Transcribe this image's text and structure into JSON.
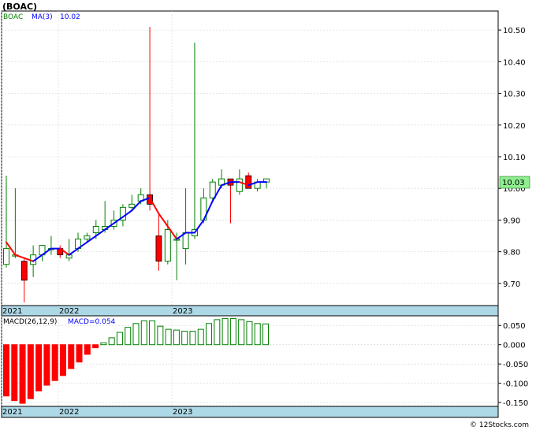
{
  "header": {
    "ticker": "(BOAC)"
  },
  "price_legend": {
    "symbol": "BOAC",
    "ma_label": "MA(3)",
    "ma_value": "10.02"
  },
  "macd_legend": {
    "label": "MACD(26,12,9)",
    "value_label": "MACD=0.054"
  },
  "last_price_tag": "10.03",
  "watermark": "© 12Stocks.com",
  "colors": {
    "up": "#008000",
    "down": "#ff0000",
    "ma_up": "#0000ff",
    "ma_down": "#ff0000",
    "axis_band": "#add8e6",
    "last_tag": "#90ee90"
  },
  "chart_data": [
    {
      "type": "candlestick",
      "title": "(BOAC)",
      "x_ticks": [
        "2021",
        "2022",
        "2023"
      ],
      "y_ticks": [
        "9.70",
        "9.80",
        "9.90",
        "10.00",
        "10.10",
        "10.20",
        "10.30",
        "10.40",
        "10.50"
      ],
      "ylim": [
        9.63,
        10.56
      ],
      "grid": true,
      "candles": [
        {
          "o": 9.76,
          "h": 10.04,
          "l": 9.75,
          "c": 9.81
        },
        {
          "o": 9.79,
          "h": 10.0,
          "l": 9.78,
          "c": 9.79
        },
        {
          "o": 9.77,
          "h": 9.78,
          "l": 9.64,
          "c": 9.71
        },
        {
          "o": 9.76,
          "h": 9.82,
          "l": 9.72,
          "c": 9.79
        },
        {
          "o": 9.79,
          "h": 9.82,
          "l": 9.77,
          "c": 9.82
        },
        {
          "o": 9.81,
          "h": 9.85,
          "l": 9.79,
          "c": 9.81
        },
        {
          "o": 9.81,
          "h": 9.82,
          "l": 9.78,
          "c": 9.79
        },
        {
          "o": 9.78,
          "h": 9.84,
          "l": 9.77,
          "c": 9.79
        },
        {
          "o": 9.81,
          "h": 9.86,
          "l": 9.8,
          "c": 9.84
        },
        {
          "o": 9.84,
          "h": 9.86,
          "l": 9.83,
          "c": 9.85
        },
        {
          "o": 9.86,
          "h": 9.9,
          "l": 9.84,
          "c": 9.88
        },
        {
          "o": 9.87,
          "h": 9.96,
          "l": 9.86,
          "c": 9.88
        },
        {
          "o": 9.88,
          "h": 9.93,
          "l": 9.87,
          "c": 9.9
        },
        {
          "o": 9.9,
          "h": 9.95,
          "l": 9.88,
          "c": 9.94
        },
        {
          "o": 9.94,
          "h": 9.98,
          "l": 9.93,
          "c": 9.95
        },
        {
          "o": 9.96,
          "h": 10.0,
          "l": 9.95,
          "c": 9.98
        },
        {
          "o": 9.98,
          "h": 10.51,
          "l": 9.93,
          "c": 9.95
        },
        {
          "o": 9.85,
          "h": 9.92,
          "l": 9.74,
          "c": 9.77
        },
        {
          "o": 9.77,
          "h": 9.9,
          "l": 9.76,
          "c": 9.87
        },
        {
          "o": 9.84,
          "h": 9.86,
          "l": 9.71,
          "c": 9.84
        },
        {
          "o": 9.81,
          "h": 10.0,
          "l": 9.76,
          "c": 9.86
        },
        {
          "o": 9.85,
          "h": 10.46,
          "l": 9.84,
          "c": 9.87
        },
        {
          "o": 9.9,
          "h": 10.0,
          "l": 9.89,
          "c": 9.97
        },
        {
          "o": 9.97,
          "h": 10.03,
          "l": 9.96,
          "c": 10.02
        },
        {
          "o": 10.01,
          "h": 10.06,
          "l": 10.0,
          "c": 10.03
        },
        {
          "o": 10.03,
          "h": 10.03,
          "l": 9.89,
          "c": 10.01
        },
        {
          "o": 9.99,
          "h": 10.06,
          "l": 9.98,
          "c": 10.03
        },
        {
          "o": 10.04,
          "h": 10.05,
          "l": 10.0,
          "c": 10.0
        },
        {
          "o": 10.0,
          "h": 10.03,
          "l": 9.99,
          "c": 10.02
        },
        {
          "o": 10.02,
          "h": 10.03,
          "l": 10.0,
          "c": 10.03
        }
      ],
      "ma3": [
        9.83,
        9.79,
        9.78,
        9.77,
        9.79,
        9.81,
        9.81,
        9.79,
        9.81,
        9.83,
        9.85,
        9.87,
        9.89,
        9.91,
        9.93,
        9.96,
        9.97,
        9.92,
        9.88,
        9.84,
        9.86,
        9.86,
        9.9,
        9.96,
        10.01,
        10.02,
        10.02,
        10.01,
        10.02,
        10.02
      ]
    },
    {
      "type": "bar",
      "title": "MACD(26,12,9)",
      "x_ticks": [
        "2021",
        "2022",
        "2023"
      ],
      "y_ticks": [
        "-0.150",
        "-0.100",
        "-0.050",
        "0.000",
        "0.050"
      ],
      "ylim": [
        -0.16,
        0.075
      ],
      "grid": true,
      "values": [
        -0.133,
        -0.145,
        -0.152,
        -0.14,
        -0.12,
        -0.105,
        -0.093,
        -0.08,
        -0.062,
        -0.045,
        -0.025,
        -0.008,
        0.005,
        0.018,
        0.032,
        0.045,
        0.055,
        0.062,
        0.062,
        0.048,
        0.04,
        0.038,
        0.035,
        0.035,
        0.04,
        0.055,
        0.065,
        0.068,
        0.068,
        0.065,
        0.06,
        0.055,
        0.054
      ]
    }
  ]
}
